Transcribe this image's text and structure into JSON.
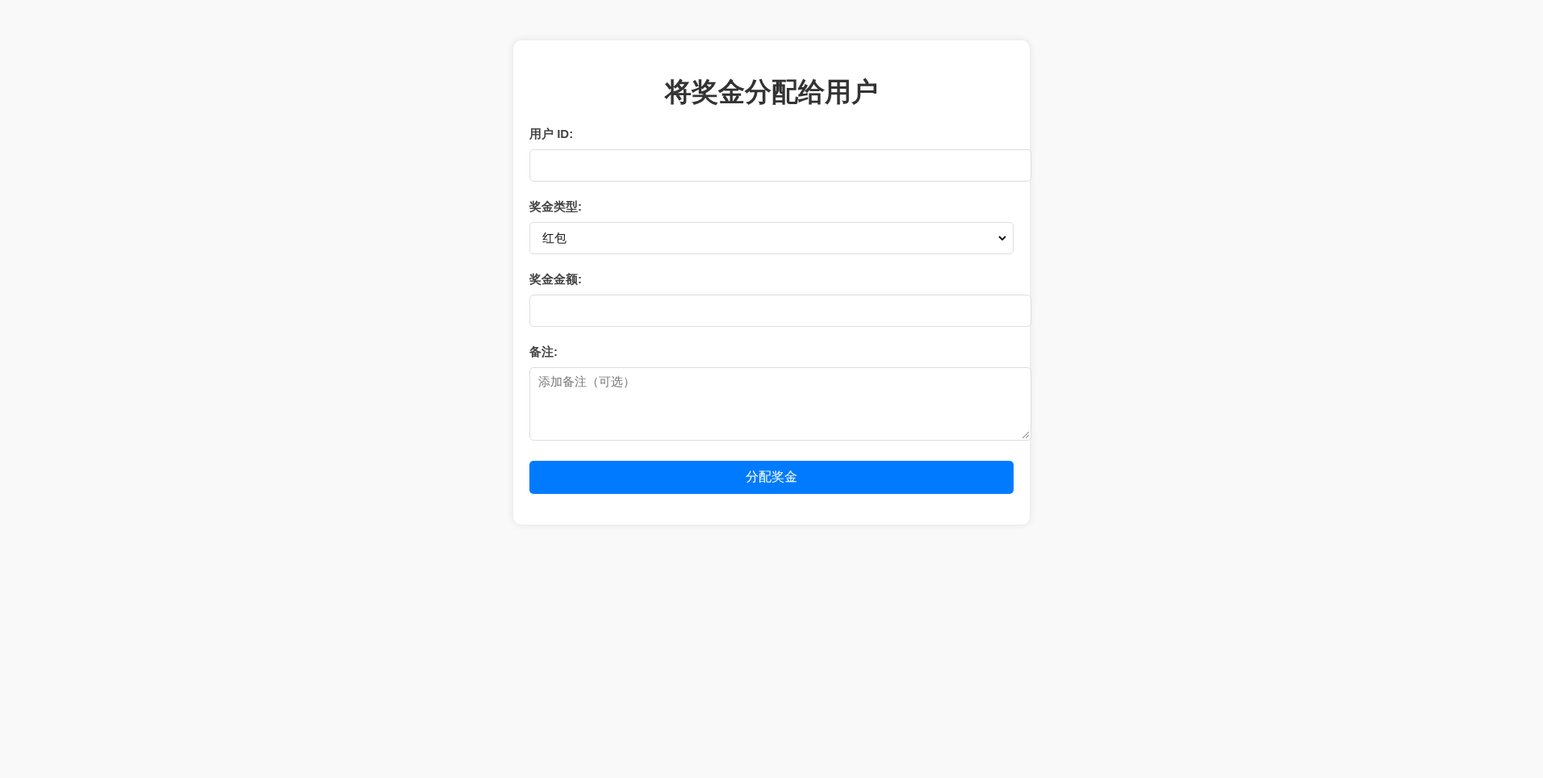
{
  "form": {
    "title": "将奖金分配给用户",
    "fields": [
      {
        "kind": "text",
        "label": "用户 ID:"
      },
      {
        "kind": "select",
        "label": "奖金类型:",
        "value": "红包"
      },
      {
        "kind": "text",
        "label": "奖金金额:"
      },
      {
        "kind": "textarea",
        "label": "备注:",
        "placeholder": "添加备注（可选）"
      }
    ],
    "submit": "分配奖金"
  }
}
